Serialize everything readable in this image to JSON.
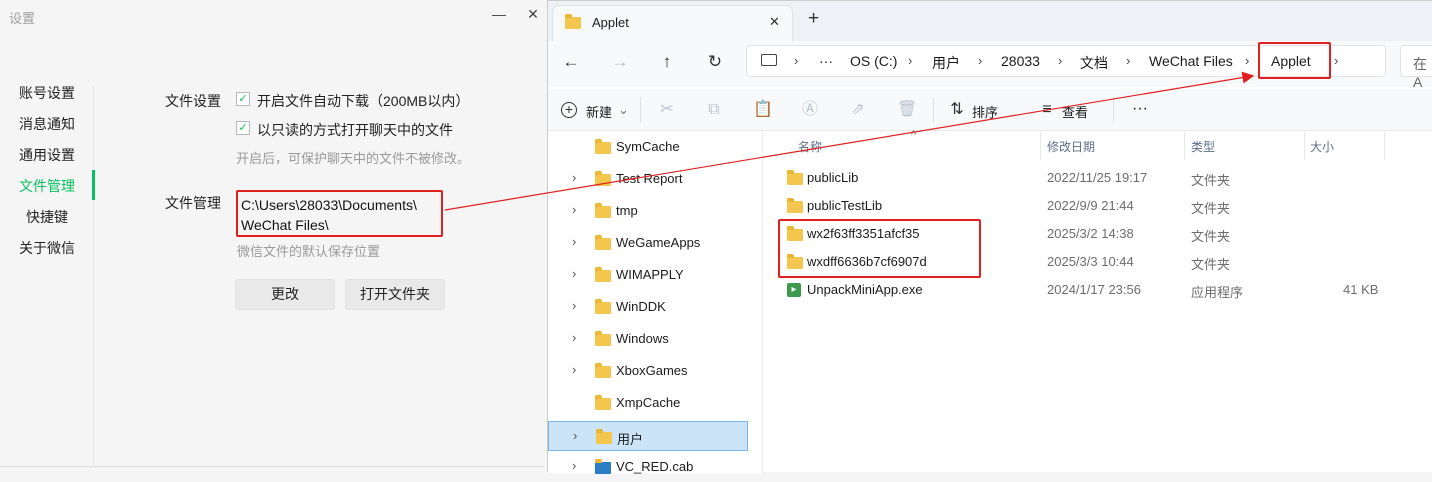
{
  "wechat": {
    "title": "设置",
    "minimize": "—",
    "close": "✕",
    "nav": [
      "账号设置",
      "消息通知",
      "通用设置",
      "文件管理",
      "快捷键",
      "关于微信"
    ],
    "file_settings": {
      "label": "文件设置",
      "auto_download": "开启文件自动下载（200MB以内）",
      "readonly_open": "以只读的方式打开聊天中的文件",
      "readonly_hint": "开启后，可保护聊天中的文件不被修改。"
    },
    "file_manage": {
      "label": "文件管理",
      "path_line1": "C:\\Users\\28033\\Documents\\",
      "path_line2": "WeChat Files\\",
      "path_hint": "微信文件的默认保存位置",
      "change_button": "更改",
      "open_folder_button": "打开文件夹"
    }
  },
  "explorer": {
    "tab_title": "Applet",
    "tab_close": "✕",
    "new_tab": "+",
    "breadcrumb": [
      "OS (C:)",
      "用户",
      "28033",
      "文档",
      "WeChat Files",
      "Applet"
    ],
    "more": "···",
    "search_placeholder": "在 A",
    "toolbar": {
      "new": "新建",
      "sort": "排序",
      "view": "查看",
      "more": "···"
    },
    "columns": {
      "name": "名称",
      "date": "修改日期",
      "type": "类型",
      "size": "大小"
    },
    "tree": [
      "SymCache",
      "Test Report",
      "tmp",
      "WeGameApps",
      "WIMAPPLY",
      "WinDDK",
      "Windows",
      "XboxGames",
      "XmpCache",
      "用户",
      "VC_RED.cab"
    ],
    "files": [
      {
        "name": "publicLib",
        "date": "2022/11/25 19:17",
        "type": "文件夹",
        "size": ""
      },
      {
        "name": "publicTestLib",
        "date": "2022/9/9 21:44",
        "type": "文件夹",
        "size": ""
      },
      {
        "name": "wx2f63ff3351afcf35",
        "date": "2025/3/2 14:38",
        "type": "文件夹",
        "size": ""
      },
      {
        "name": "wxdff6636b7cf6907d",
        "date": "2025/3/3 10:44",
        "type": "文件夹",
        "size": ""
      },
      {
        "name": "UnpackMiniApp.exe",
        "date": "2024/1/17 23:56",
        "type": "应用程序",
        "size": "41 KB"
      }
    ]
  },
  "colors": {
    "accent": "#07c160",
    "highlight": "#e02020",
    "selection": "#cce4f7"
  }
}
